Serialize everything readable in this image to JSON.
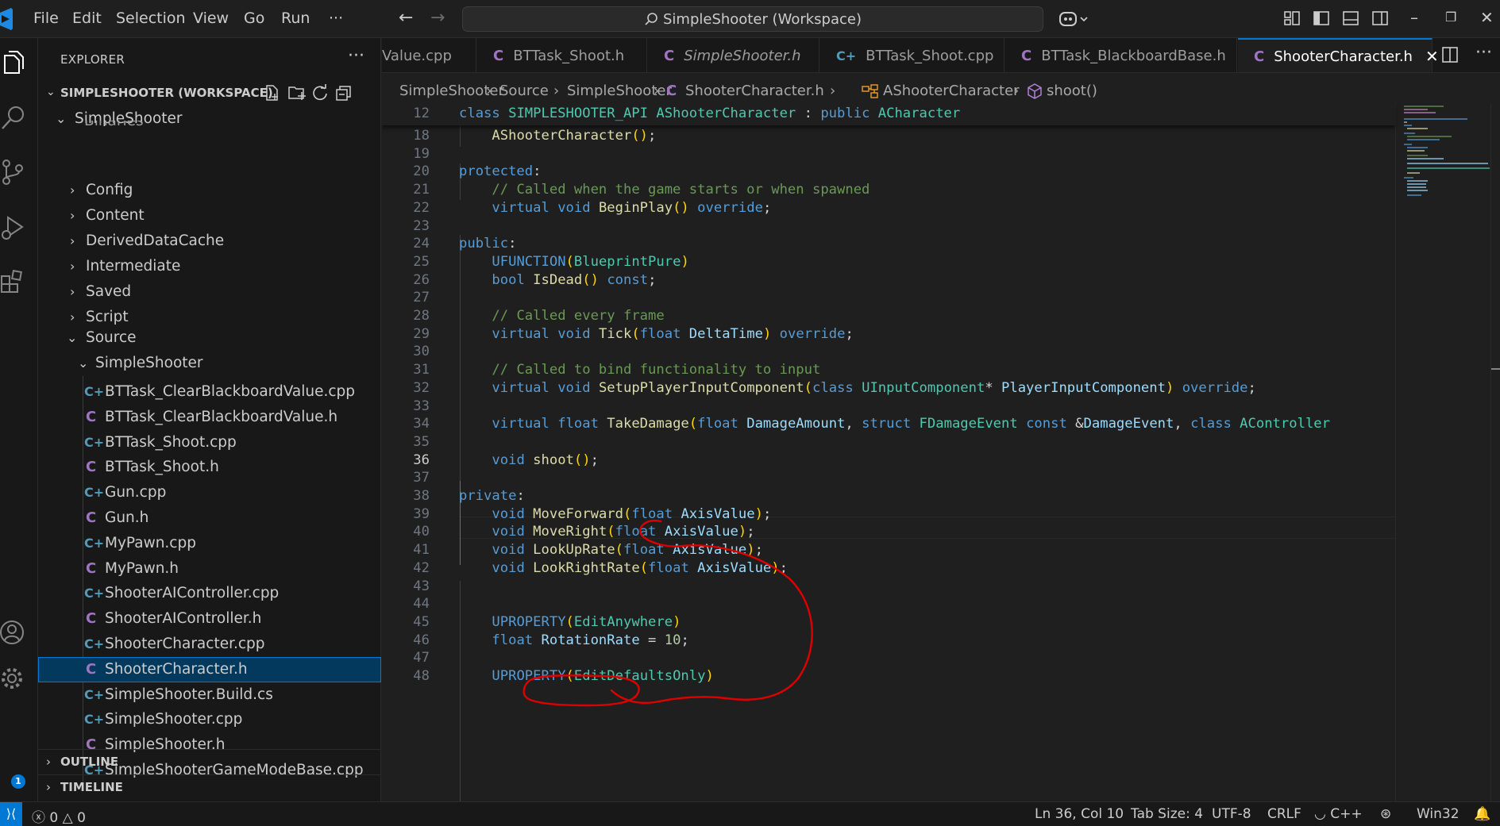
{
  "titlebar": {
    "menu": [
      "File",
      "Edit",
      "Selection",
      "View",
      "Go",
      "Run",
      "···"
    ],
    "command_center": "SimpleShooter (Workspace)"
  },
  "sidebar": {
    "title": "EXPLORER",
    "workspace": "SIMPLESHOOTER (WORKSPACE)",
    "root": "SimpleShooter",
    "partial_item": "Binaries",
    "folders": [
      "Config",
      "Content",
      "DerivedDataCache",
      "Intermediate",
      "Saved",
      "Script"
    ],
    "source": "Source",
    "subfolder": "SimpleShooter",
    "files": [
      {
        "name": "BTTask_ClearBlackboardValue.cpp",
        "icon": "cpp-icon",
        "glyph": "C+"
      },
      {
        "name": "BTTask_ClearBlackboardValue.h",
        "icon": "c-header-icon",
        "glyph": "C"
      },
      {
        "name": "BTTask_Shoot.cpp",
        "icon": "cpp-icon",
        "glyph": "C+"
      },
      {
        "name": "BTTask_Shoot.h",
        "icon": "c-header-icon",
        "glyph": "C"
      },
      {
        "name": "Gun.cpp",
        "icon": "cpp-icon",
        "glyph": "C+"
      },
      {
        "name": "Gun.h",
        "icon": "c-header-icon",
        "glyph": "C"
      },
      {
        "name": "MyPawn.cpp",
        "icon": "cpp-icon",
        "glyph": "C+"
      },
      {
        "name": "MyPawn.h",
        "icon": "c-header-icon",
        "glyph": "C"
      },
      {
        "name": "ShooterAIController.cpp",
        "icon": "cpp-icon",
        "glyph": "C+"
      },
      {
        "name": "ShooterAIController.h",
        "icon": "c-header-icon",
        "glyph": "C"
      },
      {
        "name": "ShooterCharacter.cpp",
        "icon": "cpp-icon",
        "glyph": "C+"
      },
      {
        "name": "ShooterCharacter.h",
        "icon": "c-header-icon",
        "glyph": "C",
        "selected": true
      },
      {
        "name": "SimpleShooter.Build.cs",
        "icon": "csharp-icon",
        "glyph": "C+"
      },
      {
        "name": "SimpleShooter.cpp",
        "icon": "cpp-icon",
        "glyph": "C+"
      },
      {
        "name": "SimpleShooter.h",
        "icon": "c-header-icon",
        "glyph": "C"
      },
      {
        "name": "SimpleShooterGameModeBase.cpp",
        "icon": "cpp-icon",
        "glyph": "C+"
      }
    ],
    "outline": "OUTLINE",
    "timeline": "TIMELINE",
    "accounts_badge": "1"
  },
  "tabs": [
    {
      "label": "Value.cpp",
      "icon": "",
      "glyph": ""
    },
    {
      "label": "BTTask_Shoot.h",
      "icon": "c-header-icon",
      "glyph": "C"
    },
    {
      "label": "SimpleShooter.h",
      "icon": "c-header-icon",
      "glyph": "C",
      "italic": true
    },
    {
      "label": "BTTask_Shoot.cpp",
      "icon": "cpp-icon",
      "glyph": "C+"
    },
    {
      "label": "BTTask_BlackboardBase.h",
      "icon": "c-header-icon",
      "glyph": "C"
    },
    {
      "label": "ShooterCharacter.h",
      "icon": "c-header-icon",
      "glyph": "C",
      "active": true,
      "close": "✕"
    }
  ],
  "breadcrumbs": [
    "SimpleShooter",
    "Source",
    "SimpleShooter",
    "ShooterCharacter.h",
    "AShooterCharacter",
    "shoot()"
  ],
  "editor": {
    "sticky": {
      "num": "12",
      "tokens": [
        [
          "k",
          "class "
        ],
        [
          "t",
          "SIMPLESHOOTER_API "
        ],
        [
          "t",
          "AShooterCharacter"
        ],
        [
          "o",
          " : "
        ],
        [
          "k",
          "public "
        ],
        [
          "t",
          "ACharacter"
        ]
      ]
    },
    "current_line": "36",
    "lines": [
      {
        "num": "18",
        "tokens": [
          [
            "o",
            "    "
          ],
          [
            "f",
            "AShooterCharacter"
          ],
          [
            "y",
            "()"
          ],
          [
            "o",
            ";"
          ]
        ]
      },
      {
        "num": "19",
        "tokens": []
      },
      {
        "num": "20",
        "tokens": [
          [
            "k",
            "protected"
          ],
          [
            "o",
            ":"
          ]
        ]
      },
      {
        "num": "21",
        "tokens": [
          [
            "o",
            "    "
          ],
          [
            "c",
            "// Called when the game starts or when spawned"
          ]
        ]
      },
      {
        "num": "22",
        "tokens": [
          [
            "o",
            "    "
          ],
          [
            "k",
            "virtual void "
          ],
          [
            "f",
            "BeginPlay"
          ],
          [
            "y",
            "()"
          ],
          [
            "o",
            " "
          ],
          [
            "k",
            "override"
          ],
          [
            "o",
            ";"
          ]
        ]
      },
      {
        "num": "23",
        "tokens": []
      },
      {
        "num": "24",
        "tokens": [
          [
            "k",
            "public"
          ],
          [
            "o",
            ":"
          ]
        ]
      },
      {
        "num": "25",
        "tokens": [
          [
            "o",
            "    "
          ],
          [
            "k",
            "UFUNCTION"
          ],
          [
            "y",
            "("
          ],
          [
            "t",
            "BlueprintPure"
          ],
          [
            "y",
            ")"
          ]
        ]
      },
      {
        "num": "26",
        "tokens": [
          [
            "o",
            "    "
          ],
          [
            "k",
            "bool "
          ],
          [
            "f",
            "IsDead"
          ],
          [
            "y",
            "()"
          ],
          [
            "o",
            " "
          ],
          [
            "k",
            "const"
          ],
          [
            "o",
            ";"
          ]
        ]
      },
      {
        "num": "27",
        "tokens": []
      },
      {
        "num": "28",
        "tokens": [
          [
            "o",
            "    "
          ],
          [
            "c",
            "// Called every frame"
          ]
        ]
      },
      {
        "num": "29",
        "tokens": [
          [
            "o",
            "    "
          ],
          [
            "k",
            "virtual void "
          ],
          [
            "f",
            "Tick"
          ],
          [
            "y",
            "("
          ],
          [
            "k",
            "float "
          ],
          [
            "v",
            "DeltaTime"
          ],
          [
            "y",
            ")"
          ],
          [
            "o",
            " "
          ],
          [
            "k",
            "override"
          ],
          [
            "o",
            ";"
          ]
        ]
      },
      {
        "num": "30",
        "tokens": []
      },
      {
        "num": "31",
        "tokens": [
          [
            "o",
            "    "
          ],
          [
            "c",
            "// Called to bind functionality to input"
          ]
        ]
      },
      {
        "num": "32",
        "tokens": [
          [
            "o",
            "    "
          ],
          [
            "k",
            "virtual void "
          ],
          [
            "f",
            "SetupPlayerInputComponent"
          ],
          [
            "y",
            "("
          ],
          [
            "k",
            "class "
          ],
          [
            "t",
            "UInputComponent"
          ],
          [
            "o",
            "* "
          ],
          [
            "v",
            "PlayerInputComponent"
          ],
          [
            "y",
            ")"
          ],
          [
            "o",
            " "
          ],
          [
            "k",
            "override"
          ],
          [
            "o",
            ";"
          ]
        ]
      },
      {
        "num": "33",
        "tokens": []
      },
      {
        "num": "34",
        "tokens": [
          [
            "o",
            "    "
          ],
          [
            "k",
            "virtual float "
          ],
          [
            "f",
            "TakeDamage"
          ],
          [
            "y",
            "("
          ],
          [
            "k",
            "float "
          ],
          [
            "v",
            "DamageAmount"
          ],
          [
            "o",
            ", "
          ],
          [
            "k",
            "struct "
          ],
          [
            "t",
            "FDamageEvent "
          ],
          [
            "k",
            "const "
          ],
          [
            "o",
            "&"
          ],
          [
            "v",
            "DamageEvent"
          ],
          [
            "o",
            ", "
          ],
          [
            "k",
            "class "
          ],
          [
            "t",
            "AController"
          ]
        ]
      },
      {
        "num": "35",
        "tokens": []
      },
      {
        "num": "36",
        "tokens": [
          [
            "o",
            "    "
          ],
          [
            "k",
            "void "
          ],
          [
            "f",
            "shoot"
          ],
          [
            "y",
            "()"
          ],
          [
            "o",
            ";"
          ]
        ]
      },
      {
        "num": "37",
        "tokens": []
      },
      {
        "num": "38",
        "tokens": [
          [
            "k",
            "private"
          ],
          [
            "o",
            ":"
          ]
        ]
      },
      {
        "num": "39",
        "tokens": [
          [
            "o",
            "    "
          ],
          [
            "k",
            "void "
          ],
          [
            "f",
            "MoveForward"
          ],
          [
            "y",
            "("
          ],
          [
            "k",
            "float "
          ],
          [
            "v",
            "AxisValue"
          ],
          [
            "y",
            ")"
          ],
          [
            "o",
            ";"
          ]
        ]
      },
      {
        "num": "40",
        "tokens": [
          [
            "o",
            "    "
          ],
          [
            "k",
            "void "
          ],
          [
            "f",
            "MoveRight"
          ],
          [
            "y",
            "("
          ],
          [
            "k",
            "float "
          ],
          [
            "v",
            "AxisValue"
          ],
          [
            "y",
            ")"
          ],
          [
            "o",
            ";"
          ]
        ]
      },
      {
        "num": "41",
        "tokens": [
          [
            "o",
            "    "
          ],
          [
            "k",
            "void "
          ],
          [
            "f",
            "LookUpRate"
          ],
          [
            "y",
            "("
          ],
          [
            "k",
            "float "
          ],
          [
            "v",
            "AxisValue"
          ],
          [
            "y",
            ")"
          ],
          [
            "o",
            ";"
          ]
        ]
      },
      {
        "num": "42",
        "tokens": [
          [
            "o",
            "    "
          ],
          [
            "k",
            "void "
          ],
          [
            "f",
            "LookRightRate"
          ],
          [
            "y",
            "("
          ],
          [
            "k",
            "float "
          ],
          [
            "v",
            "AxisValue"
          ],
          [
            "y",
            ")"
          ],
          [
            "o",
            ";"
          ]
        ]
      },
      {
        "num": "43",
        "tokens": []
      },
      {
        "num": "44",
        "tokens": []
      },
      {
        "num": "45",
        "tokens": [
          [
            "o",
            "    "
          ],
          [
            "k",
            "UPROPERTY"
          ],
          [
            "y",
            "("
          ],
          [
            "t",
            "EditAnywhere"
          ],
          [
            "y",
            ")"
          ]
        ]
      },
      {
        "num": "46",
        "tokens": [
          [
            "o",
            "    "
          ],
          [
            "k",
            "float "
          ],
          [
            "v",
            "RotationRate"
          ],
          [
            "o",
            " = "
          ],
          [
            "n",
            "10"
          ],
          [
            "o",
            ";"
          ]
        ]
      },
      {
        "num": "47",
        "tokens": []
      },
      {
        "num": "48",
        "tokens": [
          [
            "o",
            "    "
          ],
          [
            "k",
            "UPROPERTY"
          ],
          [
            "y",
            "("
          ],
          [
            "t",
            "EditDefaultsOnly"
          ],
          [
            "y",
            ")"
          ]
        ]
      }
    ]
  },
  "statusbar": {
    "errors": "0",
    "warnings": "0",
    "position": "Ln 36, Col 10",
    "tab_size": "Tab Size: 4",
    "encoding": "UTF-8",
    "eol": "CRLF",
    "language": "C++",
    "platform": "Win32"
  },
  "colors": {
    "accent": "#0078d4",
    "annotation": "#e00000"
  }
}
